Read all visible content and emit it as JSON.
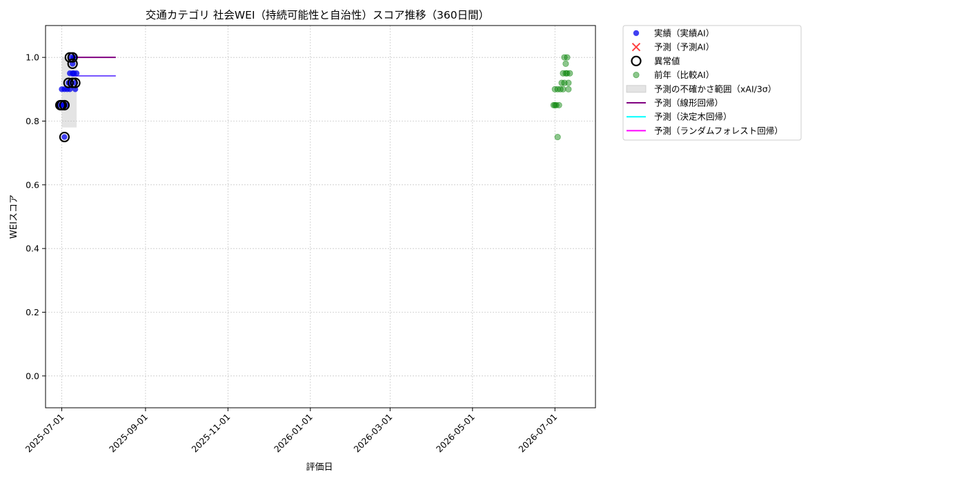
{
  "chart_data": {
    "type": "scatter",
    "title": "交通カテゴリ 社会WEI（持続可能性と自治性）スコア推移（360日間）",
    "xlabel": "評価日",
    "ylabel": "WEIスコア",
    "xlim": [
      "2025-06-19",
      "2026-07-31"
    ],
    "ylim": [
      -0.1,
      1.1
    ],
    "grid": true,
    "legend_position": "outside-top-right",
    "x_ticks": [
      "2025-07-01",
      "2025-09-01",
      "2025-11-01",
      "2026-01-01",
      "2026-03-01",
      "2026-05-01",
      "2026-07-01"
    ],
    "y_ticks": [
      "0.0",
      "0.2",
      "0.4",
      "0.6",
      "0.8",
      "1.0"
    ],
    "legend": [
      {
        "key": "actual",
        "label": "実績（実績AI）",
        "color": "#0000ee",
        "marker": "dot"
      },
      {
        "key": "forecast",
        "label": "予測（予測AI）",
        "color": "#ff0000",
        "marker": "x"
      },
      {
        "key": "anomaly",
        "label": "異常値",
        "color": "#000000",
        "marker": "ring"
      },
      {
        "key": "previous",
        "label": "前年（比較AI）",
        "color": "#008000",
        "marker": "dot-faded"
      },
      {
        "key": "band",
        "label": "予測の不確かさ範囲（xAI/3σ）",
        "color": "#cccccc",
        "marker": "rect"
      },
      {
        "key": "linear",
        "label": "予測（線形回帰）",
        "color": "#800080",
        "marker": "line"
      },
      {
        "key": "tree",
        "label": "予測（決定木回帰）",
        "color": "#00ffff",
        "marker": "line"
      },
      {
        "key": "forest",
        "label": "予測（ランダムフォレスト回帰）",
        "color": "#ff00ff",
        "marker": "line"
      }
    ],
    "series": [
      {
        "key": "actual",
        "name": "実績（実績AI）",
        "color": "#0000ee",
        "points": [
          {
            "x": "2025-06-30",
            "y": 0.85
          },
          {
            "x": "2025-07-01",
            "y": 0.85
          },
          {
            "x": "2025-07-01",
            "y": 0.9
          },
          {
            "x": "2025-07-02",
            "y": 0.85
          },
          {
            "x": "2025-07-03",
            "y": 0.75
          },
          {
            "x": "2025-07-03",
            "y": 0.9
          },
          {
            "x": "2025-07-04",
            "y": 0.85
          },
          {
            "x": "2025-07-05",
            "y": 0.9
          },
          {
            "x": "2025-07-06",
            "y": 0.92
          },
          {
            "x": "2025-07-07",
            "y": 0.9
          },
          {
            "x": "2025-07-07",
            "y": 0.95
          },
          {
            "x": "2025-07-08",
            "y": 0.92
          },
          {
            "x": "2025-07-08",
            "y": 1.0
          },
          {
            "x": "2025-07-09",
            "y": 0.95
          },
          {
            "x": "2025-07-09",
            "y": 0.98
          },
          {
            "x": "2025-07-10",
            "y": 1.0
          },
          {
            "x": "2025-07-10",
            "y": 0.95
          },
          {
            "x": "2025-07-11",
            "y": 0.92
          },
          {
            "x": "2025-07-11",
            "y": 0.9
          },
          {
            "x": "2025-07-12",
            "y": 0.95
          }
        ]
      },
      {
        "key": "anomaly",
        "name": "異常値",
        "color": "#000000",
        "points": [
          {
            "x": "2025-06-30",
            "y": 0.85
          },
          {
            "x": "2025-07-01",
            "y": 0.85
          },
          {
            "x": "2025-07-03",
            "y": 0.85
          },
          {
            "x": "2025-07-03",
            "y": 0.75
          },
          {
            "x": "2025-07-06",
            "y": 0.92
          },
          {
            "x": "2025-07-07",
            "y": 1.0
          },
          {
            "x": "2025-07-09",
            "y": 0.98
          },
          {
            "x": "2025-07-09",
            "y": 1.0
          },
          {
            "x": "2025-07-09",
            "y": 0.92
          },
          {
            "x": "2025-07-11",
            "y": 0.92
          }
        ]
      },
      {
        "key": "previous",
        "name": "前年（比較AI）",
        "color": "#008000",
        "points": [
          {
            "x": "2026-06-30",
            "y": 0.85
          },
          {
            "x": "2026-07-01",
            "y": 0.85
          },
          {
            "x": "2026-07-01",
            "y": 0.9
          },
          {
            "x": "2026-07-02",
            "y": 0.85
          },
          {
            "x": "2026-07-03",
            "y": 0.75
          },
          {
            "x": "2026-07-03",
            "y": 0.9
          },
          {
            "x": "2026-07-04",
            "y": 0.85
          },
          {
            "x": "2026-07-05",
            "y": 0.9
          },
          {
            "x": "2026-07-06",
            "y": 0.92
          },
          {
            "x": "2026-07-07",
            "y": 0.9
          },
          {
            "x": "2026-07-07",
            "y": 0.95
          },
          {
            "x": "2026-07-08",
            "y": 0.92
          },
          {
            "x": "2026-07-08",
            "y": 1.0
          },
          {
            "x": "2026-07-09",
            "y": 0.95
          },
          {
            "x": "2026-07-09",
            "y": 0.98
          },
          {
            "x": "2026-07-10",
            "y": 1.0
          },
          {
            "x": "2026-07-10",
            "y": 0.95
          },
          {
            "x": "2026-07-11",
            "y": 0.92
          },
          {
            "x": "2026-07-11",
            "y": 0.9
          },
          {
            "x": "2026-07-12",
            "y": 0.95
          }
        ]
      }
    ],
    "uncertainty_band": {
      "x_start": "2025-07-01",
      "x_end": "2025-07-12",
      "y_low": 0.78,
      "y_high": 1.0
    },
    "forecast_lines": [
      {
        "key": "linear",
        "name": "予測（線形回帰）",
        "color": "#800080",
        "points": [
          {
            "x": "2025-07-08",
            "y": 1.0
          },
          {
            "x": "2025-08-10",
            "y": 1.0
          }
        ]
      },
      {
        "key": "forest",
        "name": "予測（ランダムフォレスト回帰）",
        "color": "#7755ff",
        "points": [
          {
            "x": "2025-07-08",
            "y": 0.942
          },
          {
            "x": "2025-08-10",
            "y": 0.942
          }
        ]
      }
    ]
  }
}
